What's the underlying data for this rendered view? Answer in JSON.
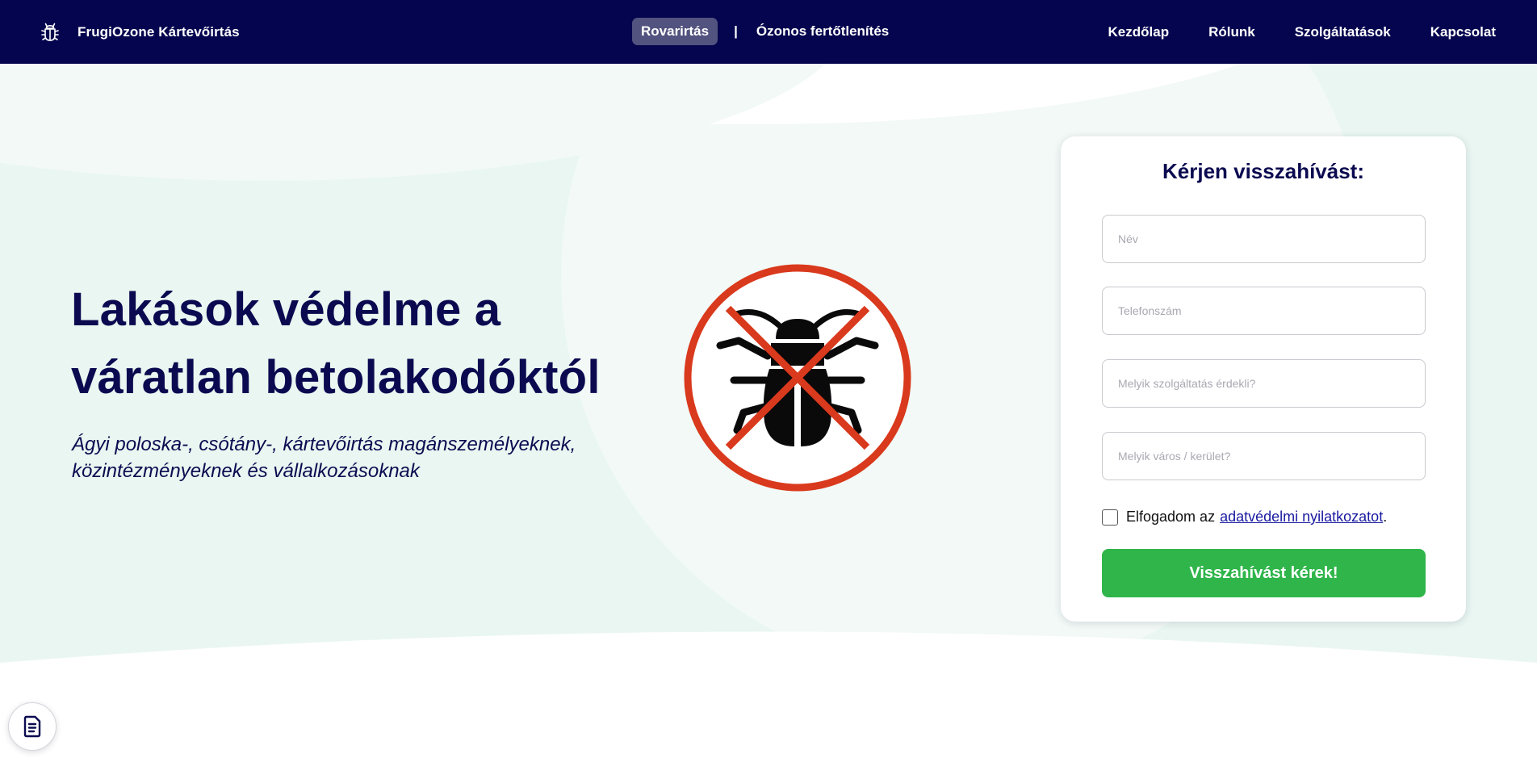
{
  "nav": {
    "brand": "FrugiOzone Kártevőirtás",
    "brand_icon": "bug-icon",
    "center_links": [
      "Rovarirtás",
      "Ózonos fertőtlenítés"
    ],
    "separator": "|",
    "main_links": [
      "Kezdőlap",
      "Rólunk",
      "Szolgáltatások",
      "Kapcsolat"
    ]
  },
  "hero": {
    "title_line1": "Lakások védelme a",
    "title_line2": "váratlan betolakodóktól",
    "subtitle_line1": "Ágyi poloska-, csótány-, kártevőirtás magánszemélyeknek,",
    "subtitle_line2": "közintézményeknek és vállalkozásoknak",
    "illustration_icon": "no-bugs-icon"
  },
  "form": {
    "title": "Kérjen visszahívást:",
    "fields": {
      "name_placeholder": "Név",
      "phone_placeholder": "Telefonszám",
      "service_placeholder": "Melyik szolgáltatás érdekli?",
      "city_placeholder": "Melyik város / kerület?"
    },
    "consent_prefix": "Elfogadom az",
    "consent_link": "adatvédelmi nyilatkozatot",
    "consent_suffix": ".",
    "consent_checked": false,
    "submit_label": "Visszahívást kérek!"
  },
  "widget": {
    "icon": "document-icon"
  },
  "colors": {
    "navbar": "#05054f",
    "active_pill": "#52537f",
    "heading": "#0b0a50",
    "submit": "#2fb54a",
    "hero_bg": "#e9f6f1",
    "prohibit_red": "#d9391c"
  }
}
